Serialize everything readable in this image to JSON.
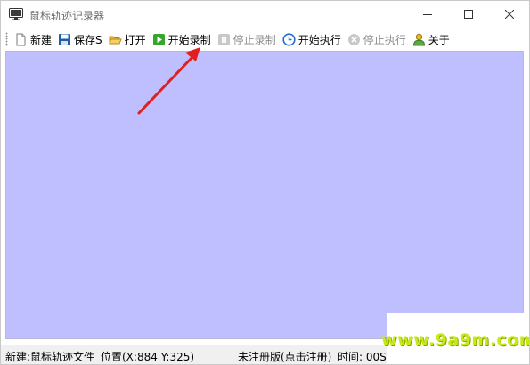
{
  "window": {
    "title": "鼠标轨迹记录器"
  },
  "toolbar": {
    "items": [
      {
        "label": "新建",
        "icon": "new-file-icon",
        "enabled": true
      },
      {
        "label": "保存S",
        "icon": "save-icon",
        "enabled": true
      },
      {
        "label": "打开",
        "icon": "open-folder-icon",
        "enabled": true
      },
      {
        "label": "开始录制",
        "icon": "play-record-icon",
        "enabled": true
      },
      {
        "label": "停止录制",
        "icon": "pause-record-icon",
        "enabled": false
      },
      {
        "label": "开始执行",
        "icon": "clock-icon",
        "enabled": true
      },
      {
        "label": "停止执行",
        "icon": "stop-icon",
        "enabled": false
      },
      {
        "label": "关于",
        "icon": "user-icon",
        "enabled": true
      }
    ]
  },
  "canvas": {
    "background": "#bfbfff"
  },
  "annotation": {
    "arrow_color": "#e02020"
  },
  "statusbar": {
    "file": "新建:鼠标轨迹文件",
    "position": "位置(X:884 Y:325)",
    "registration": "未注册版(点击注册)",
    "time": "时间: 00S"
  },
  "watermark": {
    "text": "www.9a9m.com"
  }
}
